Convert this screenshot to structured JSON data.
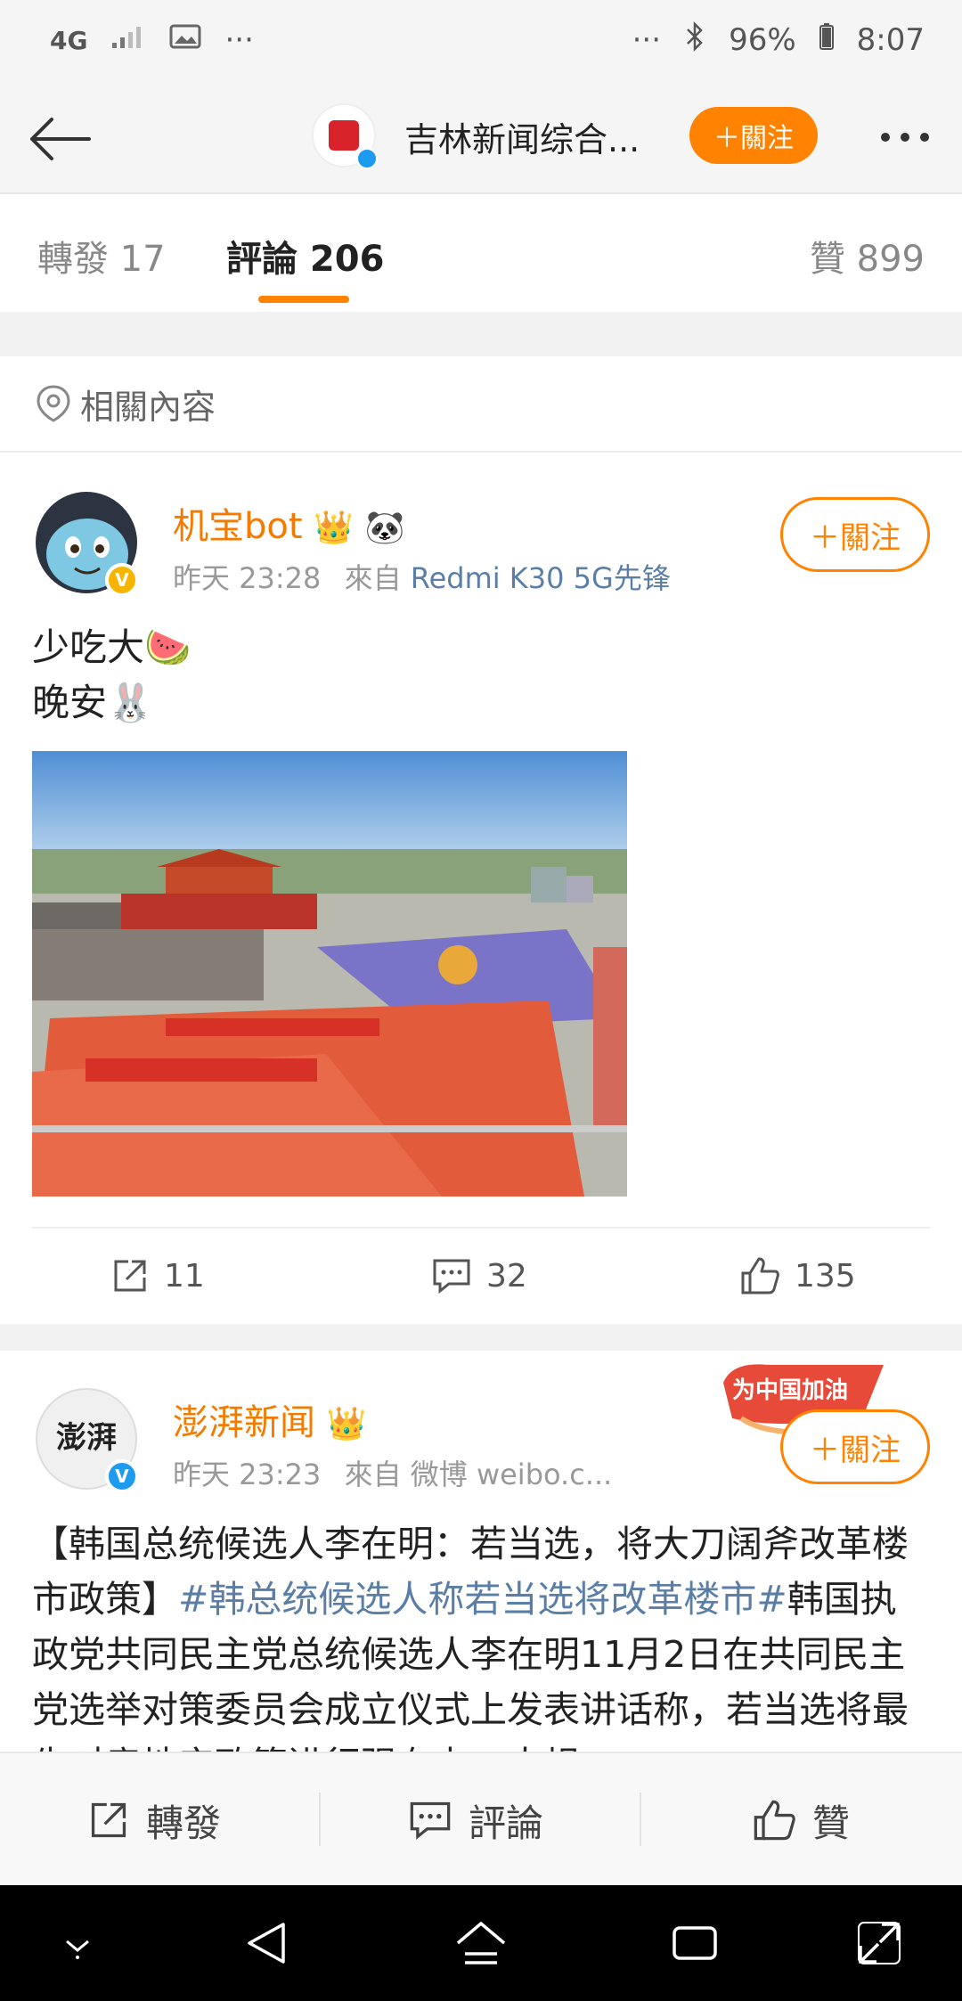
{
  "status_bar": {
    "network": "4G",
    "battery": "96%",
    "time": "8:07"
  },
  "header": {
    "title": "吉林新闻综合...",
    "follow_label": "＋關注"
  },
  "tabs": [
    {
      "label": "轉發 17"
    },
    {
      "label": "評論 206"
    },
    {
      "label": "贊 899"
    }
  ],
  "related": {
    "label": "相關內容"
  },
  "posts": [
    {
      "username": "机宝bot",
      "time": "昨天 23:28",
      "from_label": "來自",
      "source": "Redmi K30 5G先锋",
      "follow_label": "＋關注",
      "text_lines": [
        "少吃大🍉",
        "晚安🐰"
      ],
      "reposts": "11",
      "comments": "32",
      "likes": "135"
    },
    {
      "username": "澎湃新闻",
      "time": "昨天 23:23",
      "from_label": "來自",
      "source": "微博 weibo.c...",
      "follow_label": "＋關注",
      "sticker_text": "为中国加油",
      "text_a": "【韩国总统候选人李在明：若当选，将大刀阔斧改革楼市政策】",
      "hashtag": "#韩总统候选人称若当选将改革楼市#",
      "text_b": "韩国执政党共同民主党总统候选人李在明11月2日在共同民主党选举对策委员会成立仪式上发表讲话称，若当选将最先对房地产政策进行强有力、大规"
    }
  ],
  "bottom_bar": {
    "repost": "轉發",
    "comment": "評論",
    "like": "贊"
  },
  "colors": {
    "accent": "#ff8200",
    "username": "#f47b00",
    "link": "#5b7ea6"
  }
}
